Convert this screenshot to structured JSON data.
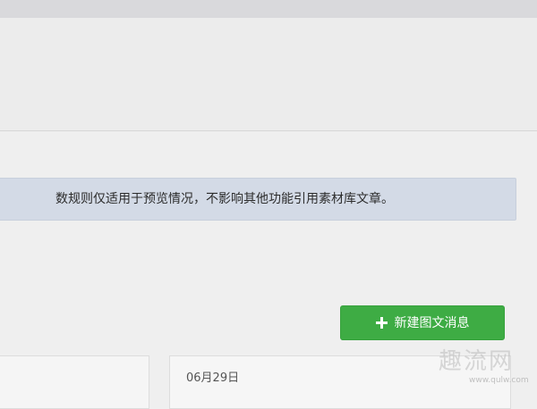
{
  "notice": {
    "text": "数规则仅适用于预览情况，不影响其他功能引用素材库文章。"
  },
  "toolbar": {
    "new_post_label": "新建图文消息"
  },
  "cards": [
    {
      "date": ""
    },
    {
      "date": "06月29日"
    }
  ],
  "watermark": {
    "logo": "趣流网",
    "url": "www.qulw.com"
  },
  "colors": {
    "notice_background": "#d3dae6",
    "primary_button": "#3eac44",
    "page_background": "#efefef"
  },
  "icons": {
    "new_post_icon": "plus-icon"
  }
}
